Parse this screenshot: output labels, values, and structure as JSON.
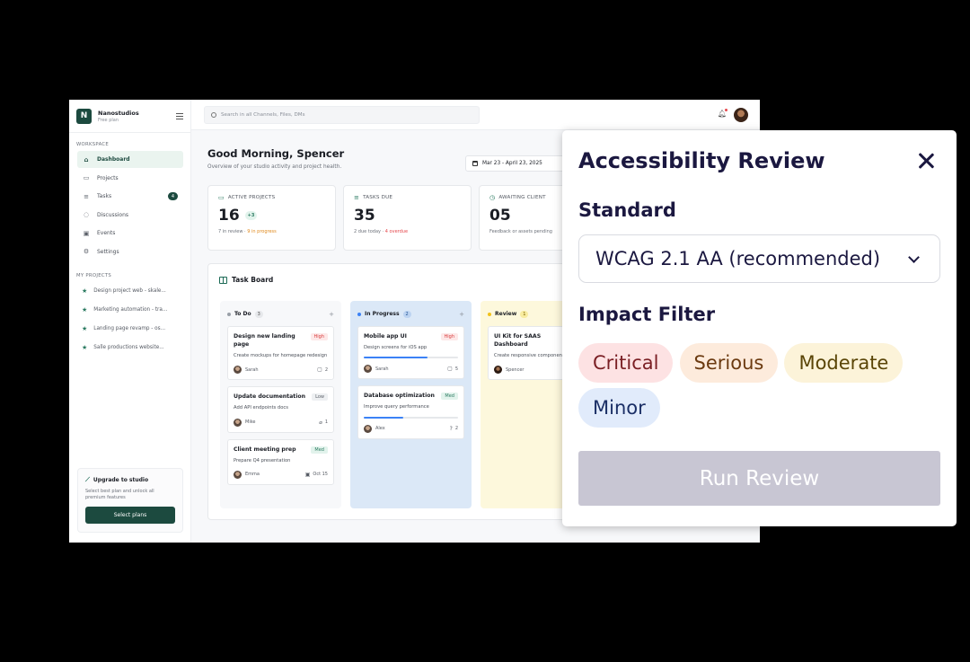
{
  "brand": {
    "logo": "N",
    "name": "Nanostudios",
    "plan": "Free plan"
  },
  "sidebar": {
    "workspace_label": "WORKSPACE",
    "items": [
      {
        "label": "Dashboard",
        "icon": "home-icon"
      },
      {
        "label": "Projects",
        "icon": "folder-icon"
      },
      {
        "label": "Tasks",
        "icon": "list-icon",
        "badge": "4"
      },
      {
        "label": "Discussions",
        "icon": "chat-icon"
      },
      {
        "label": "Events",
        "icon": "calendar-icon"
      },
      {
        "label": "Settings",
        "icon": "gear-icon"
      }
    ],
    "projects_label": "MY PROJECTS",
    "projects": [
      "Design project web - skale...",
      "Marketing automation - tra...",
      "Landing page revamp - os...",
      "Salle productions website..."
    ],
    "upgrade": {
      "title": "Upgrade to studio",
      "desc": "Select best plan and unlock all premium features",
      "button": "Select plans"
    }
  },
  "topbar": {
    "search_placeholder": "Search in all Channels, Files, DMs"
  },
  "main": {
    "greeting": "Good Morning, Spencer",
    "subtitle": "Overview of your studio activity and project health.",
    "date_range": "Mar 23 - April 23, 2025",
    "stats": [
      {
        "label": "ACTIVE PROJECTS",
        "value": "16",
        "delta": "+3",
        "sub_a": "7 in review",
        "sub_sep": " · ",
        "sub_b": "9 in progress"
      },
      {
        "label": "TASKS DUE",
        "value": "35",
        "sub_a": "2 due today",
        "sub_sep": " · ",
        "sub_b": "4 overdue"
      },
      {
        "label": "AWAITING CLIENT",
        "value": "05",
        "sub_a": "Feedback or assets pending"
      }
    ]
  },
  "board": {
    "title": "Task Board",
    "columns": [
      {
        "name": "To Do",
        "count": "3",
        "cards": [
          {
            "title": "Design new landing page",
            "priority": "High",
            "desc": "Create mockups for homepage redesign",
            "assignee": "Sarah",
            "meta": "2"
          },
          {
            "title": "Update documentation",
            "priority": "Low",
            "desc": "Add API endpoints docs",
            "assignee": "Mike",
            "meta": "1"
          },
          {
            "title": "Client meeting prep",
            "priority": "Med",
            "desc": "Prepare Q4 presentation",
            "assignee": "Emma",
            "meta": "Oct 15"
          }
        ]
      },
      {
        "name": "In Progress",
        "count": "2",
        "cards": [
          {
            "title": "Mobile app UI",
            "priority": "High",
            "desc": "Design screens for iOS app",
            "progress": 0.68,
            "assignee": "Sarah",
            "meta": "5"
          },
          {
            "title": "Database optimization",
            "priority": "Med",
            "desc": "Improve query performance",
            "progress": 0.42,
            "assignee": "Alex",
            "meta": "2"
          }
        ]
      },
      {
        "name": "Review",
        "count": "1",
        "cards": [
          {
            "title": "UI Kit for SAAS Dashboard",
            "desc": "Create responsive componen",
            "assignee": "Spencer"
          }
        ]
      }
    ]
  },
  "modal": {
    "title": "Accessibility Review",
    "standard_label": "Standard",
    "standard_value": "WCAG 2.1 AA (recommended)",
    "impact_label": "Impact Filter",
    "chips": [
      "Critical",
      "Serious",
      "Moderate",
      "Minor"
    ],
    "run_button": "Run Review"
  },
  "colors": {
    "brand": "#1c4a3f",
    "accent": "#2a7a60",
    "modal_text": "#1b1840",
    "run_disabled": "#c8c6d3"
  }
}
